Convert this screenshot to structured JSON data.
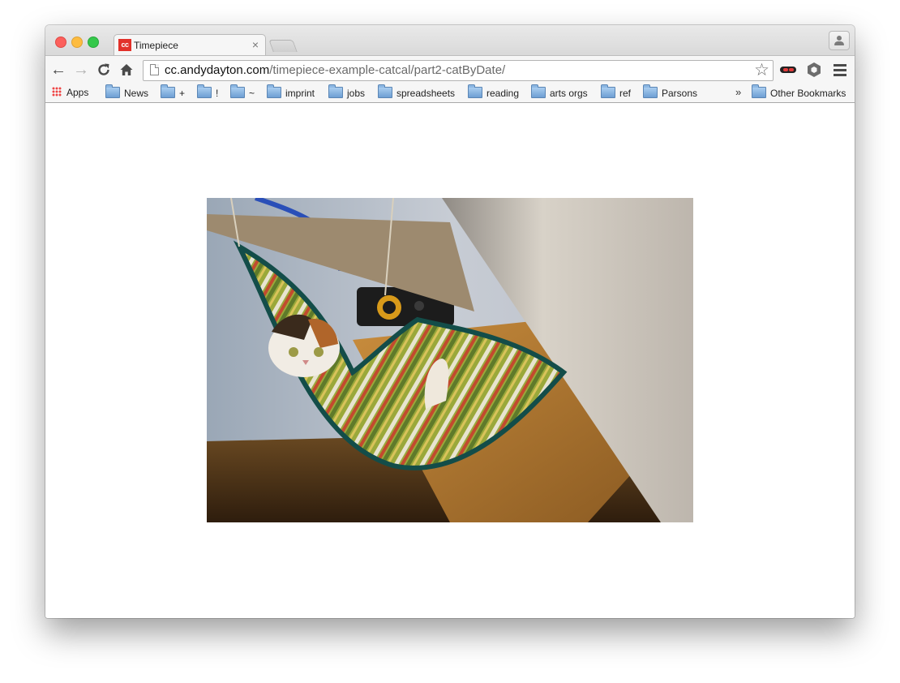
{
  "tab": {
    "favicon_text": "cc",
    "title": "Timepiece",
    "close": "×"
  },
  "toolbar": {
    "back": "←",
    "forward": "→",
    "reload": "C",
    "home": "⌂",
    "url_host": "cc.andydayton.com",
    "url_path": "/timepiece-example-catcal/part2-catByDate/",
    "bookmark_star": "☆",
    "extension_icons": [
      "ninja-mask-icon",
      "hexagon-icon"
    ],
    "menu_icon": "hamburger-menu-icon"
  },
  "bookmarks": {
    "apps": "Apps",
    "items": [
      "News",
      "+",
      "!",
      "~",
      "imprint",
      "jobs",
      "spreadsheets",
      "reading",
      "arts orgs",
      "ref",
      "Parsons"
    ],
    "overflow": "»",
    "other": "Other Bookmarks"
  },
  "content": {
    "image_description_icon": "cat-in-hammock-photo"
  }
}
